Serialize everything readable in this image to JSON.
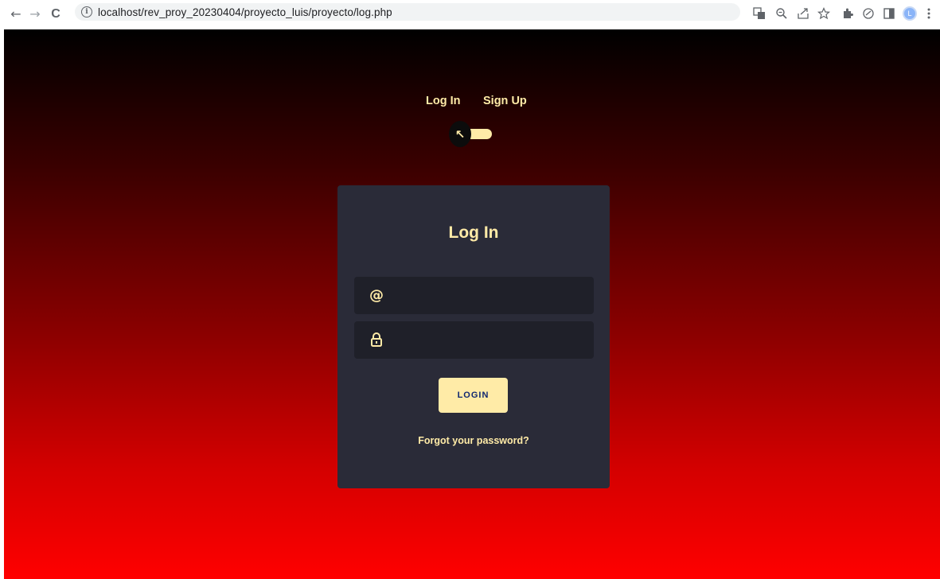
{
  "browser": {
    "url": "localhost/rev_proy_20230404/proyecto_luis/proyecto/log.php",
    "back_glyph": "←",
    "forward_glyph": "→",
    "reload_glyph": "C",
    "info_glyph": "i",
    "avatar_initial": "L",
    "icons": [
      "translate-icon",
      "zoom-icon",
      "share-icon",
      "bookmark-star-icon",
      "extensions-icon",
      "extension-icon",
      "side-panel-icon",
      "profile-avatar",
      "menu-icon"
    ]
  },
  "page": {
    "tabs": {
      "login": "Log In",
      "signup": "Sign Up"
    },
    "toggle_glyph": "↖",
    "card": {
      "title": "Log In",
      "email_icon": "@",
      "email_placeholder": "",
      "password_icon": "🔒",
      "password_placeholder": "",
      "login_button": "LOGIN",
      "forgot_link": "Forgot your password?"
    }
  },
  "colors": {
    "accent": "#ffeba7",
    "card_bg": "#2a2b38",
    "field_bg": "#1f2029",
    "button_text": "#102770",
    "gradient_top": "#000000",
    "gradient_bottom": "#ff0000"
  }
}
